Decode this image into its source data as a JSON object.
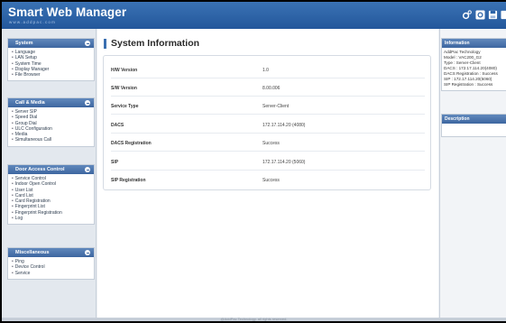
{
  "header": {
    "brand_title": "Smart Web Manager",
    "brand_subtitle": "www.addpac.com",
    "icons": [
      "gear-icon",
      "gear-icon",
      "save-icon",
      "logout-icon"
    ],
    "accent_color": "#2c64a8"
  },
  "sidebar": {
    "sections": [
      {
        "title": "System",
        "items": [
          "Language",
          "LAN Setup",
          "System Time",
          "Display Manager",
          "File Browser"
        ]
      },
      {
        "title": "Call & Media",
        "items": [
          "Server SIP",
          "Speed Dial",
          "Group Dial",
          "ULC Configuration",
          "Media",
          "Simultaneous Call"
        ]
      },
      {
        "title": "Door Access Control",
        "items": [
          "Service Control",
          "Indoor Open Control",
          "User List",
          "Card List",
          "Card Registration",
          "Fingerprint List",
          "Fingerprint Registration",
          "Log"
        ]
      },
      {
        "title": "Miscellaneous",
        "items": [
          "Ping",
          "Device Control",
          "Service"
        ]
      }
    ]
  },
  "main": {
    "title": "System Information",
    "rows": [
      {
        "label": "H/W Version",
        "value": "1.0"
      },
      {
        "label": "S/W Version",
        "value": "8.00.006"
      },
      {
        "label": "Service Type",
        "value": "Server-Client"
      },
      {
        "label": "DACS",
        "value": "172.17.114.20 (4080)"
      },
      {
        "label": "DACS Registration",
        "value": "Success"
      },
      {
        "label": "SIP",
        "value": "172.17.114.20 (5060)"
      },
      {
        "label": "SIP Registration",
        "value": "Success"
      }
    ]
  },
  "right_panel": {
    "information": {
      "title": "Information",
      "lines": [
        "AddPac Technology",
        "Model : VAC200_G2",
        "Type : Server-Client",
        "DACS : 172.17.114.20(4080)",
        "DACS Registration : Success",
        "SIP : 172.17.114.20(5060)",
        "SIP Registration : Success"
      ]
    },
    "description": {
      "title": "Description"
    }
  },
  "footer": {
    "text": "@AddPac Technology. all rights reserved."
  }
}
